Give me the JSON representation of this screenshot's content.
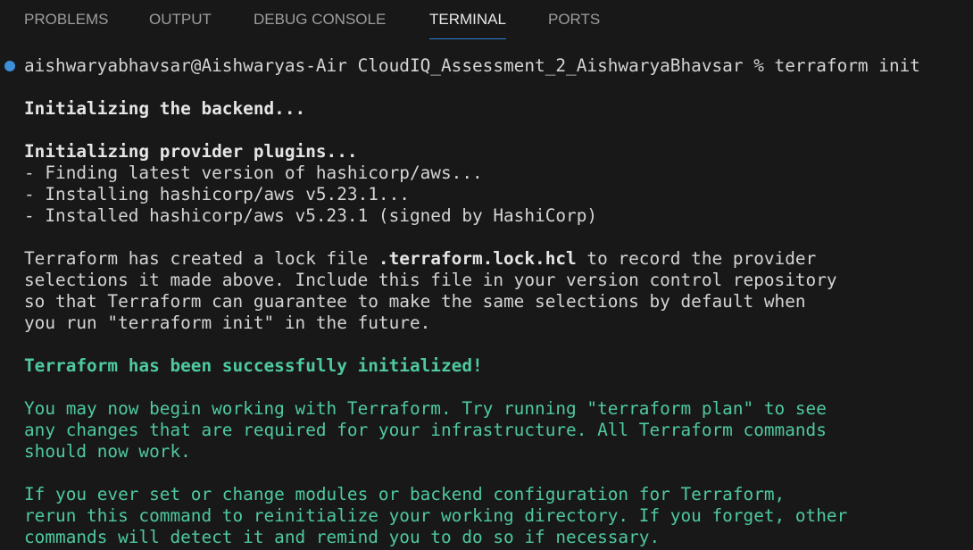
{
  "tabs": [
    {
      "label": "PROBLEMS",
      "active": false
    },
    {
      "label": "OUTPUT",
      "active": false
    },
    {
      "label": "DEBUG CONSOLE",
      "active": false
    },
    {
      "label": "TERMINAL",
      "active": true
    },
    {
      "label": "PORTS",
      "active": false
    }
  ],
  "terminal": {
    "prompt": "aishwaryabhavsar@Aishwaryas-Air CloudIQ_Assessment_2_AishwaryaBhavsar % terraform init",
    "backend": "Initializing the backend...",
    "plugins_title": "Initializing provider plugins...",
    "plugin_lines": [
      "- Finding latest version of hashicorp/aws...",
      "- Installing hashicorp/aws v5.23.1...",
      "- Installed hashicorp/aws v5.23.1 (signed by HashiCorp)"
    ],
    "lock_pre": "Terraform has created a lock file ",
    "lock_file": ".terraform.lock.hcl",
    "lock_post": " to record the provider",
    "lock_lines": [
      "selections it made above. Include this file in your version control repository",
      "so that Terraform can guarantee to make the same selections by default when",
      "you run \"terraform init\" in the future."
    ],
    "success": "Terraform has been successfully initialized!",
    "next_lines": [
      "You may now begin working with Terraform. Try running \"terraform plan\" to see",
      "any changes that are required for your infrastructure. All Terraform commands",
      "should now work."
    ],
    "rerun_lines": [
      "If you ever set or change modules or backend configuration for Terraform,",
      "rerun this command to reinitialize your working directory. If you forget, other",
      "commands will detect it and remind you to do so if necessary."
    ]
  },
  "colors": {
    "background": "#181818",
    "text": "#d4d4d4",
    "success": "#4ec9a0",
    "accent": "#2f7fd8",
    "dot": "#3c8fdb"
  }
}
